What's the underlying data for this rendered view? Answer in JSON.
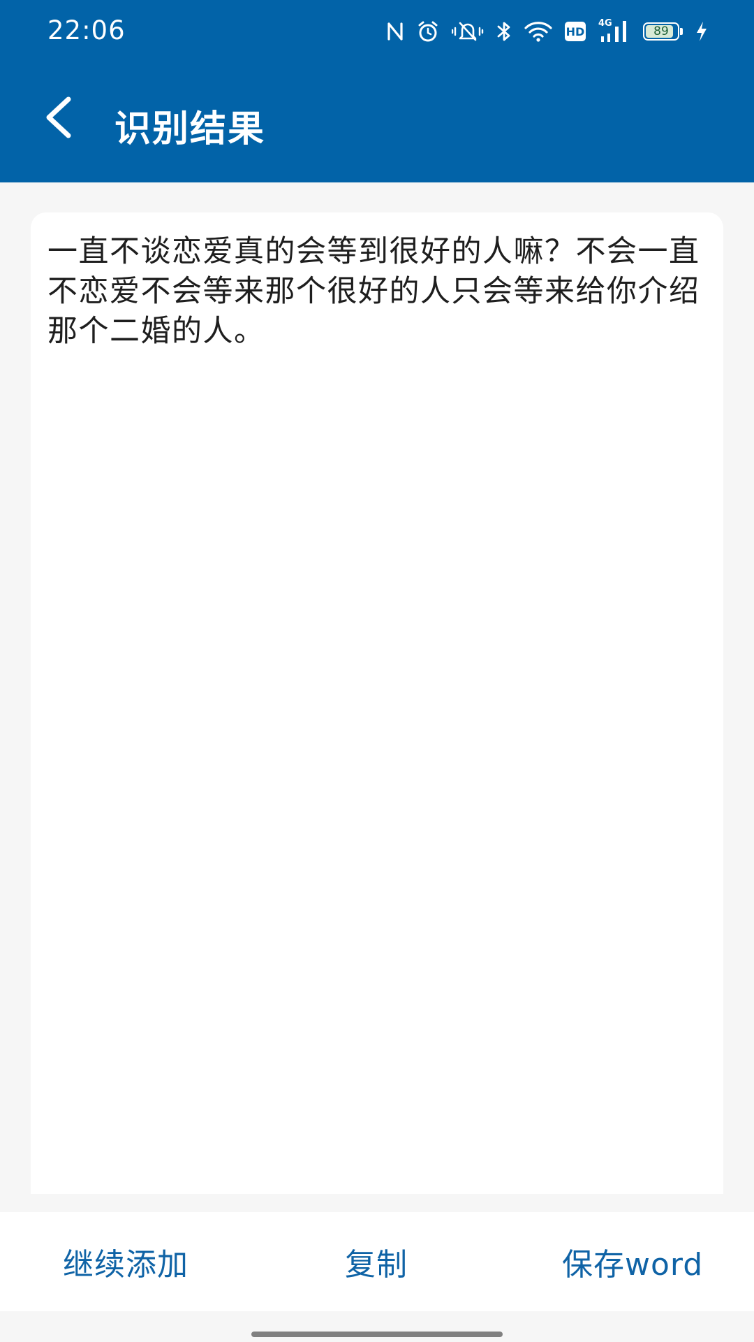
{
  "status_bar": {
    "time": "22:06",
    "network": "4G",
    "hd_label": "HD",
    "battery_level": "89",
    "icons": [
      "nfc-icon",
      "alarm-icon",
      "vibrate-icon",
      "bluetooth-icon",
      "wifi-icon",
      "hd-icon",
      "signal-icon",
      "battery-icon",
      "charging-icon"
    ]
  },
  "header": {
    "title": "识别结果",
    "back_icon": "chevron-left-icon",
    "background_color": "#0263a8"
  },
  "result": {
    "text": "一直不谈恋爱真的会等到很好的人嘛？不会一直不恋爱不会等来那个很好的人只会等来给你介绍那个二婚的人。"
  },
  "actions": {
    "continue_add": "继续添加",
    "copy": "复制",
    "save_word": "保存word",
    "accent_color": "#0f63a6"
  }
}
